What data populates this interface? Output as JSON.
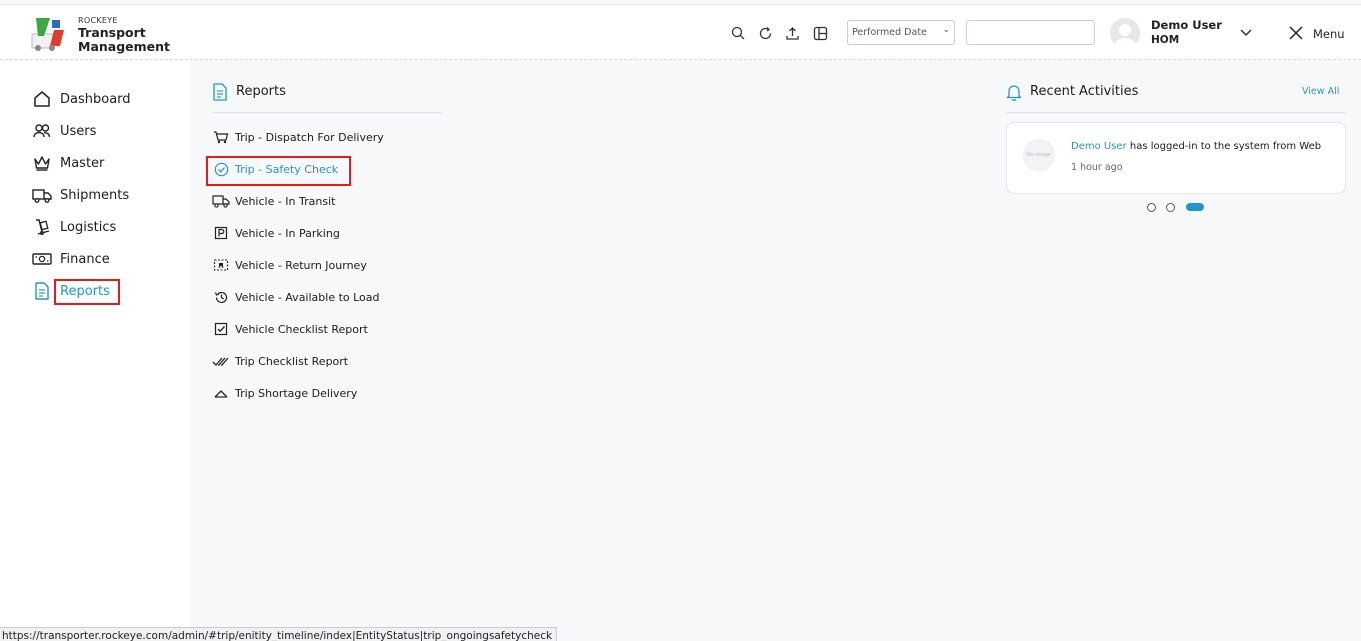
{
  "brand": {
    "small": "ROCKEYE",
    "line1": "Transport",
    "line2": "Management"
  },
  "header": {
    "icons": [
      "search-icon",
      "refresh-icon",
      "upload-icon",
      "layout-icon"
    ],
    "date_select": "Performed Date",
    "date_input_value": "",
    "user_name": "Demo User",
    "user_role": "HOM",
    "menu_label": "Menu"
  },
  "sidebar": {
    "items": [
      {
        "label": "Dashboard",
        "icon": "home-icon"
      },
      {
        "label": "Users",
        "icon": "users-icon"
      },
      {
        "label": "Master",
        "icon": "crown-icon"
      },
      {
        "label": "Shipments",
        "icon": "truck-icon"
      },
      {
        "label": "Logistics",
        "icon": "hand-truck-icon"
      },
      {
        "label": "Finance",
        "icon": "money-icon"
      },
      {
        "label": "Reports",
        "icon": "document-icon",
        "active": true
      }
    ]
  },
  "reports": {
    "title": "Reports",
    "items": [
      {
        "label": "Trip - Dispatch For Delivery",
        "icon": "cart-icon"
      },
      {
        "label": "Trip - Safety Check",
        "icon": "check-circle-icon",
        "active": true
      },
      {
        "label": "Vehicle - In Transit",
        "icon": "truck-icon"
      },
      {
        "label": "Vehicle - In Parking",
        "icon": "parking-icon"
      },
      {
        "label": "Vehicle - Return Journey",
        "icon": "return-icon"
      },
      {
        "label": "Vehicle - Available to Load",
        "icon": "history-icon"
      },
      {
        "label": "Vehicle Checklist Report",
        "icon": "checkbox-icon"
      },
      {
        "label": "Trip Checklist Report",
        "icon": "double-check-icon"
      },
      {
        "label": "Trip Shortage Delivery",
        "icon": "triangle-icon"
      }
    ]
  },
  "recent": {
    "title": "Recent Activities",
    "view_all": "View All",
    "no_image": "No image",
    "activity_user": "Demo User",
    "activity_text": " has logged-in to the system from Web",
    "activity_time": "1 hour ago",
    "pager": {
      "count": 3,
      "active": 3
    }
  },
  "status_url": "https://transporter.rockeye.com/admin/#trip/enitity_timeline/index|EntityStatus|trip_ongoingsafetycheck",
  "colors": {
    "accent": "#2196c9",
    "highlight": "#e01e1e"
  }
}
